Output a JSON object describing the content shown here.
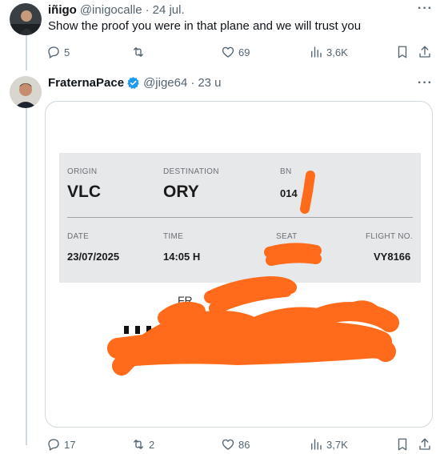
{
  "tweet1": {
    "name": "iñigo",
    "handle": "@inigocalle",
    "time": "24 jul.",
    "text": "Show the proof you were in that plane and we will trust you",
    "reply_count": "5",
    "retweet_count": "",
    "like_count": "69",
    "view_count": "3,6K"
  },
  "tweet2": {
    "name": "FraternaPace",
    "handle": "@jige64",
    "time": "23 u",
    "reply_count": "17",
    "retweet_count": "2",
    "like_count": "86",
    "view_count": "3,7K",
    "verified_color": "#1d9bf0"
  },
  "boarding_pass": {
    "origin_label": "ORIGIN",
    "origin": "VLC",
    "destination_label": "DESTINATION",
    "destination": "ORY",
    "bn_label": "BN",
    "bn": "014",
    "date_label": "DATE",
    "date": "23/07/2025",
    "time_label": "TIME",
    "time": "14:05 H",
    "seat_label": "SEAT",
    "flight_label": "FLIGHT NO.",
    "flight": "VY8166",
    "name_partial": "FR",
    "redaction_color": "#ff6b1a"
  },
  "more_label": "···"
}
